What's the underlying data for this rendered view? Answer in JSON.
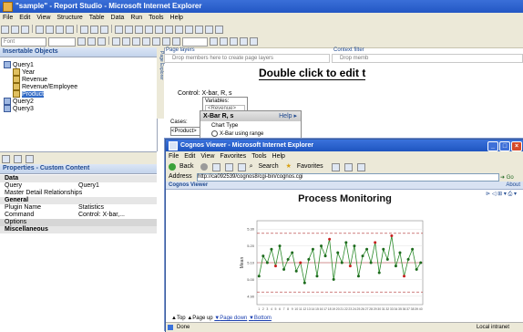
{
  "report_studio": {
    "title": "\"sample\" - Report Studio - Microsoft Internet Explorer",
    "menu": [
      "File",
      "Edit",
      "View",
      "Structure",
      "Table",
      "Data",
      "Run",
      "Tools",
      "Help"
    ],
    "font_combo": "Font",
    "insertable_objects": {
      "header": "Insertable Objects",
      "tree": [
        {
          "label": "Query1",
          "level": 0,
          "selected": false
        },
        {
          "label": "Year",
          "level": 1,
          "selected": false
        },
        {
          "label": "Revenue",
          "level": 1,
          "selected": false
        },
        {
          "label": "Revenue/Employee",
          "level": 1,
          "selected": false
        },
        {
          "label": "Product",
          "level": 1,
          "selected": true
        },
        {
          "label": "Query2",
          "level": 0,
          "selected": false
        },
        {
          "label": "Query3",
          "level": 0,
          "selected": false
        }
      ]
    },
    "properties": {
      "header": "Properties - Custom Content",
      "rows": [
        {
          "name": "Data",
          "value": "",
          "section": true
        },
        {
          "name": "Query",
          "value": "Query1",
          "section": false
        },
        {
          "name": "Master Detail Relationships",
          "value": "",
          "section": false
        },
        {
          "name": "General",
          "value": "",
          "section": true
        },
        {
          "name": "Plugin Name",
          "value": "Statistics",
          "section": false
        },
        {
          "name": "Command",
          "value": "Control: X-bar,...",
          "section": false
        },
        {
          "name": "Options",
          "value": "",
          "section": false,
          "selected": true
        },
        {
          "name": "Miscellaneous",
          "value": "",
          "section": true
        }
      ]
    },
    "page_layers": {
      "label": "Page layers",
      "hint": "Drop members here to create page layers"
    },
    "context_filter": {
      "label": "Context filter",
      "hint": "Drop memb"
    },
    "vertical_tab": "Page Explorer",
    "canvas_title": "Double click to edit t",
    "control_label": "Control: X-bar, R, s",
    "variables_label": "Variables:",
    "variables_placeholder": "<Revenue>",
    "cases_label": "Cases:",
    "cases_value": "<Product>",
    "xbar_panel": {
      "title": "X-Bar R, s",
      "help": "Help",
      "chart_type": "Chart Type",
      "option": "X-Bar using range"
    }
  },
  "cognos_viewer": {
    "title": "Cognos Viewer - Microsoft Internet Explorer",
    "menu": [
      "File",
      "Edit",
      "View",
      "Favorites",
      "Tools",
      "Help"
    ],
    "toolbar": {
      "back": "Back",
      "search": "Search",
      "favorites": "Favorites"
    },
    "address_label": "Address",
    "address_value": "http://ca092539/cognos8/cgi-bin/cognos.cgi",
    "go_label": "Go",
    "tab_label": "Cognos Viewer",
    "tab_right": "About",
    "nav": {
      "top": "Top",
      "page_up": "Page up",
      "page_down": "Page down",
      "bottom": "Bottom"
    },
    "status_done": "Done",
    "status_zone": "Local intranet"
  },
  "chart_data": {
    "type": "line",
    "title": "Process Monitoring",
    "ylabel": "Mean",
    "xlabel": "",
    "ylim": [
      4.85,
      5.35
    ],
    "y_ticks": [
      4.9,
      5.0,
      5.1,
      5.2,
      5.3
    ],
    "reference_lines": {
      "ucl": 5.275,
      "center": 5.1,
      "lcl": 4.925
    },
    "x": [
      1,
      2,
      3,
      4,
      5,
      6,
      7,
      8,
      9,
      10,
      11,
      12,
      13,
      14,
      15,
      16,
      17,
      18,
      19,
      20,
      21,
      22,
      23,
      24,
      25,
      26,
      27,
      28,
      29,
      30,
      31,
      32,
      33,
      34,
      35,
      36,
      37,
      38,
      39,
      40
    ],
    "values": [
      5.02,
      5.14,
      5.1,
      5.18,
      5.08,
      5.2,
      5.06,
      5.12,
      5.16,
      5.05,
      5.1,
      4.98,
      5.12,
      5.18,
      5.02,
      5.2,
      5.14,
      5.24,
      5.0,
      5.16,
      5.1,
      5.22,
      5.08,
      5.2,
      5.02,
      5.14,
      5.18,
      5.1,
      5.22,
      5.04,
      5.18,
      5.12,
      5.26,
      5.08,
      5.16,
      5.02,
      5.12,
      5.18,
      5.06,
      5.1
    ],
    "out_of_control": [
      5,
      11,
      18,
      23,
      29,
      33,
      36
    ],
    "colors": {
      "line": "#2a8a2a",
      "marker": "#1e6b1e",
      "alarm": "#c82020",
      "ref": "#b03030"
    }
  }
}
